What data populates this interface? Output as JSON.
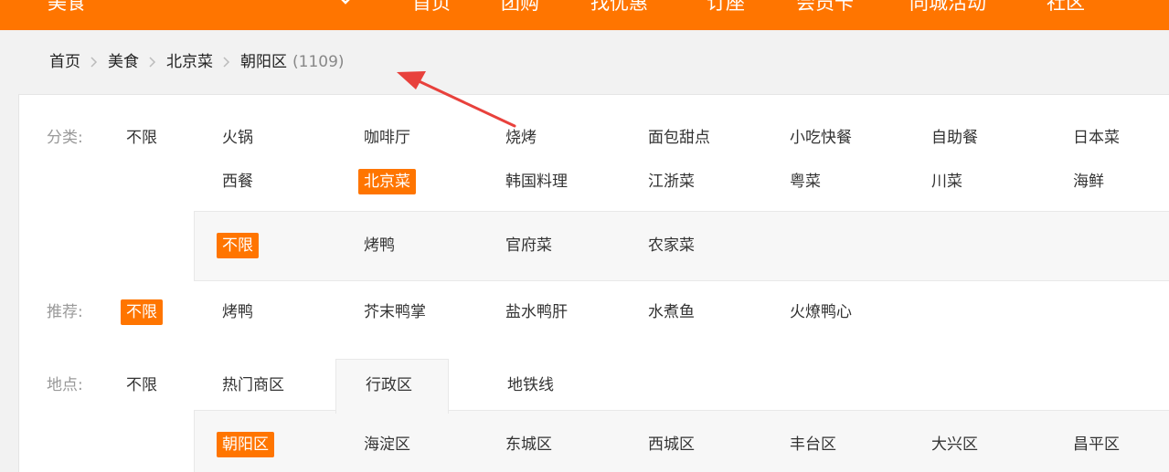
{
  "topnav": {
    "city": "美食",
    "links": [
      "首页",
      "团购",
      "找优惠",
      "订座",
      "会员卡",
      "同城活动",
      "社区"
    ]
  },
  "breadcrumb": {
    "items": [
      "首页",
      "美食",
      "北京菜"
    ],
    "current": "朝阳区",
    "count": "(1109)"
  },
  "filters": {
    "category": {
      "label": "分类:",
      "all": "不限",
      "row1": [
        "火锅",
        "咖啡厅",
        "烧烤",
        "面包甜点",
        "小吃快餐",
        "自助餐",
        "日本菜"
      ],
      "row2": [
        "西餐",
        "北京菜",
        "韩国料理",
        "江浙菜",
        "粤菜",
        "川菜",
        "海鲜"
      ],
      "sub": [
        "不限",
        "烤鸭",
        "官府菜",
        "农家菜"
      ]
    },
    "recommend": {
      "label": "推荐:",
      "all": "不限",
      "items": [
        "烤鸭",
        "芥末鸭掌",
        "盐水鸭肝",
        "水煮鱼",
        "火燎鸭心"
      ]
    },
    "location": {
      "label": "地点:",
      "all": "不限",
      "tabs": [
        "热门商区",
        "行政区",
        "地铁线"
      ],
      "districts": [
        "朝阳区",
        "海淀区",
        "东城区",
        "西城区",
        "丰台区",
        "大兴区",
        "昌平区"
      ]
    }
  },
  "colors": {
    "accent": "#ff7500",
    "annotation": "#e8413c"
  }
}
